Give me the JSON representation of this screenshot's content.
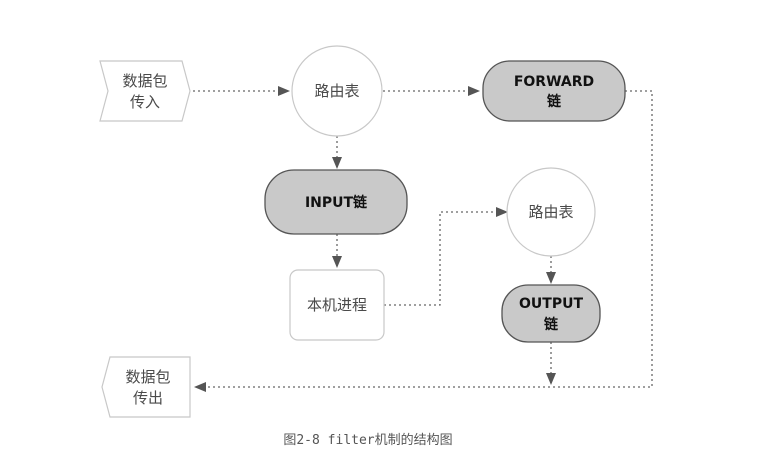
{
  "nodes": {
    "packet_in": {
      "line1": "数据包",
      "line2": "传入"
    },
    "routing_table_1": {
      "label": "路由表"
    },
    "forward_chain": {
      "line1": "FORWARD",
      "line2": "链"
    },
    "input_chain": {
      "label": "INPUT链"
    },
    "routing_table_2": {
      "label": "路由表"
    },
    "local_process": {
      "label": "本机进程"
    },
    "output_chain": {
      "line1": "OUTPUT",
      "line2": "链"
    },
    "packet_out": {
      "line1": "数据包",
      "line2": "传出"
    }
  },
  "caption": "图2-8  filter机制的结构图",
  "colors": {
    "chain_fill": "#c9c9c9",
    "chain_stroke": "#555555",
    "light_stroke": "#c8c8c8",
    "arrow": "#555555"
  }
}
